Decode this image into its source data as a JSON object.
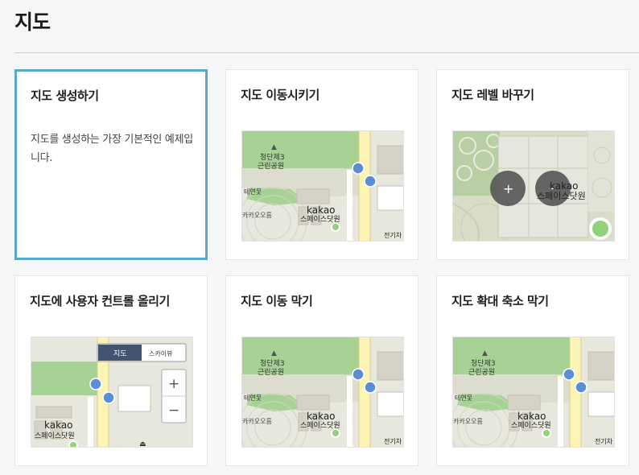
{
  "header": {
    "title": "지도"
  },
  "cards": [
    {
      "title": "지도 생성하기",
      "description": "지도를 생성하는 가장 기본적인 예제입니다."
    },
    {
      "title": "지도 이동시키기"
    },
    {
      "title": "지도 레벨 바꾸기"
    },
    {
      "title": "지도에 사용자 컨트롤 올리기"
    },
    {
      "title": "지도 이동 막기"
    },
    {
      "title": "지도 확대 축소 막기"
    }
  ],
  "map": {
    "park_name": "청단제3 근린공원",
    "park_line1": "청단제3",
    "park_line2": "근린공원",
    "label_teyeonmot": "테연못",
    "label_kakao_orom": "카카오오름",
    "kakao_line1": "kakao",
    "kakao_line2": "스페이스닷원",
    "label_jeongi": "전기차",
    "controls": {
      "map_type_map": "지도",
      "map_type_skyview": "스카이뷰",
      "zoom_in": "+",
      "zoom_out": "−"
    },
    "colors": {
      "park": "#a6d395",
      "road": "#fbf4b4",
      "ground": "#e8e7dd",
      "bus": "#5a8fd6"
    }
  }
}
